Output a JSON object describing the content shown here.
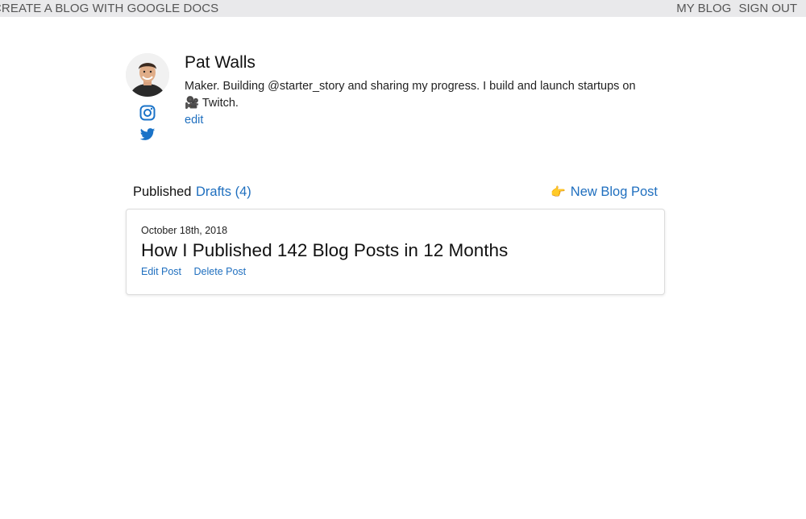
{
  "topbar": {
    "brand": "CREATE A BLOG WITH GOOGLE DOCS",
    "nav": [
      "MY BLOG",
      "SIGN OUT"
    ]
  },
  "profile": {
    "name": "Pat Walls",
    "bio": "Maker. Building @starter_story and sharing my progress. I build and launch startups on 🎥 Twitch.",
    "edit_label": "edit",
    "social_icons": [
      "instagram-icon",
      "twitter-icon"
    ]
  },
  "tabs": {
    "published": "Published",
    "drafts": "Drafts (4)"
  },
  "new_post": {
    "icon": "👉",
    "label": "New Blog Post"
  },
  "posts": [
    {
      "date": "October 18th, 2018",
      "title": "How I Published 142 Blog Posts in 12 Months",
      "edit_label": "Edit Post",
      "delete_label": "Delete Post"
    }
  ],
  "colors": {
    "link": "#1f6fbf",
    "topbar_bg": "#e9e9eb",
    "social_icon": "#1a73c8"
  }
}
